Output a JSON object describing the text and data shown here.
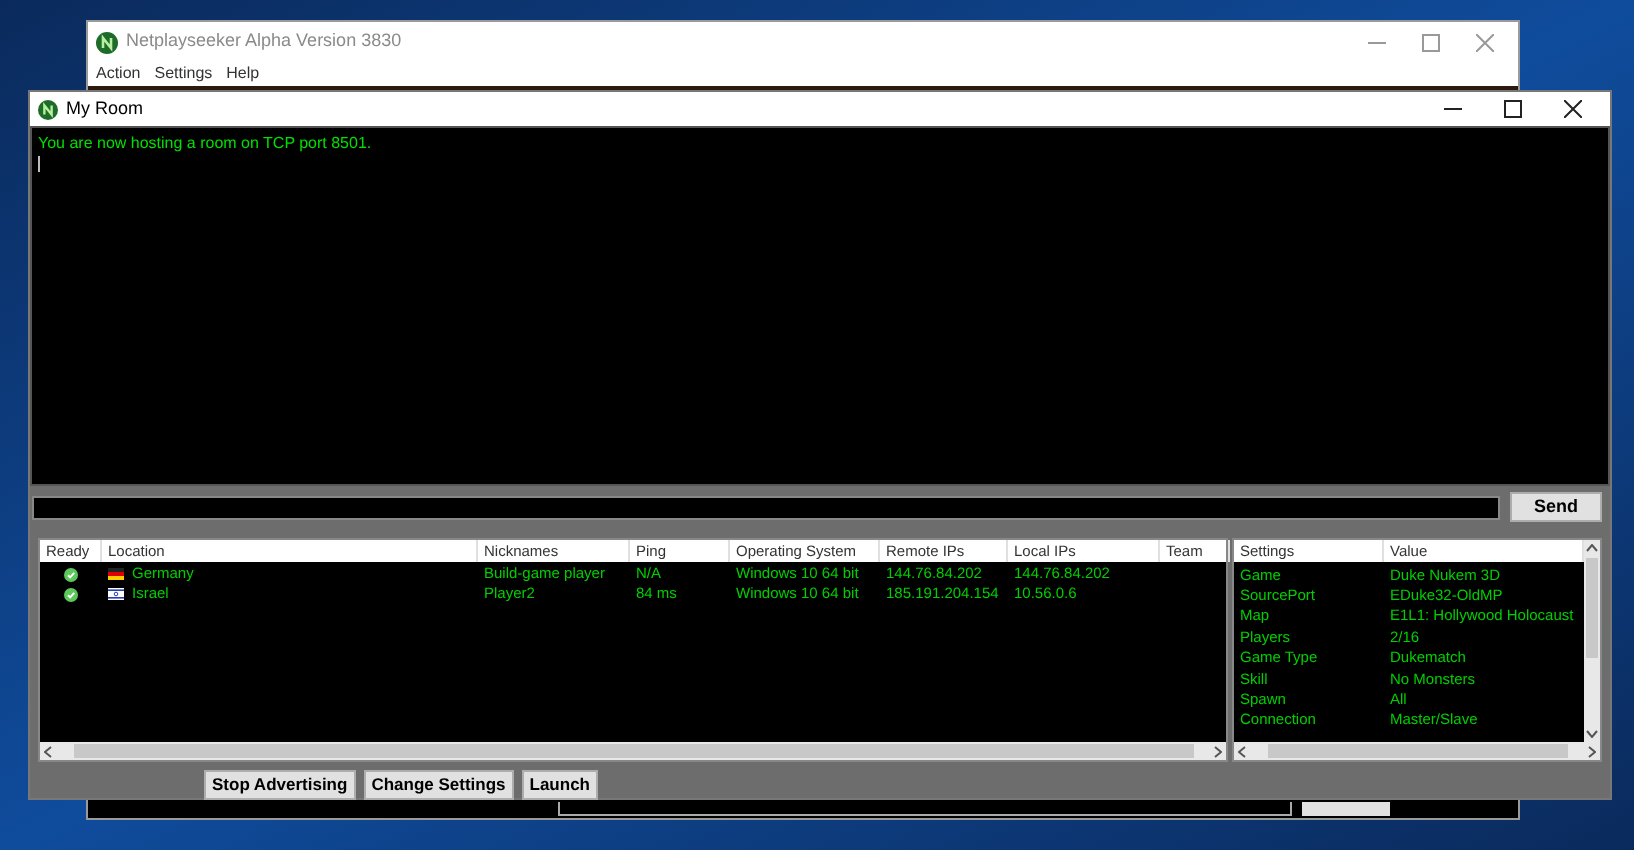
{
  "main_window": {
    "title": "Netplayseeker Alpha Version 3830",
    "menu": [
      "Action",
      "Settings",
      "Help"
    ]
  },
  "room_window": {
    "title": "My Room",
    "chat_log": [
      "You are now hosting a room on TCP port 8501."
    ],
    "send_button": "Send",
    "players": {
      "columns": [
        "Ready",
        "Location",
        "Nicknames",
        "Ping",
        "Operating System",
        "Remote IPs",
        "Local IPs",
        "Team"
      ],
      "rows": [
        {
          "ready": true,
          "kind": "de",
          "location": "Germany",
          "nickname": "Build-game player",
          "ping": "N/A",
          "os": "Windows 10 64 bit",
          "remote_ip": "144.76.84.202",
          "local_ip": "144.76.84.202"
        },
        {
          "ready": true,
          "kind": "il",
          "location": "Israel",
          "nickname": "Player2",
          "ping": "84 ms",
          "os": "Windows 10 64 bit",
          "remote_ip": "185.191.204.154",
          "local_ip": "10.56.0.6"
        }
      ]
    },
    "settings": {
      "columns": [
        "Settings",
        "Value"
      ],
      "rows": [
        {
          "setting": "Game",
          "value": "Duke Nukem 3D"
        },
        {
          "setting": "SourcePort",
          "value": "EDuke32-OldMP"
        },
        {
          "setting": "Map",
          "value": "E1L1: Hollywood Holocaust"
        },
        {
          "setting": "Players",
          "value": "2/16"
        },
        {
          "setting": "Game Type",
          "value": "Dukematch"
        },
        {
          "setting": "Skill",
          "value": "No Monsters"
        },
        {
          "setting": "Spawn",
          "value": "All"
        },
        {
          "setting": "Connection",
          "value": "Master/Slave"
        }
      ]
    },
    "buttons": [
      "Stop Advertising",
      "Change Settings",
      "Launch"
    ]
  }
}
